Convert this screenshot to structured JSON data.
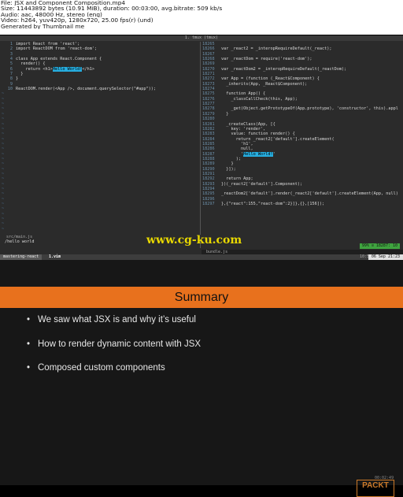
{
  "meta": {
    "lines": [
      "File: JSX and Component Composition.mp4",
      "Size: 11443892 bytes (10.91 MiB), duration: 00:03:00, avg.bitrate: 509 kb/s",
      "Audio: aac, 48000 Hz, stereo (eng)",
      "Video: h264, yuv420p, 1280x720, 25.00 fps(r) (und)",
      "Generated by Thumbnail me"
    ]
  },
  "tmux": {
    "title": "1. tmux (tmux)",
    "session": "mastering-react",
    "window": "1.vim",
    "time": "10:57",
    "date": "06 Sep 21:23"
  },
  "left_pane": {
    "lines": [
      {
        "n": "1",
        "t": "import React from 'react';"
      },
      {
        "n": "2",
        "t": "import ReactDOM from 'react-dom';"
      },
      {
        "n": "3",
        "t": ""
      },
      {
        "n": "4",
        "t": "class App extends React.Component {"
      },
      {
        "n": "5",
        "t": "  render() {"
      },
      {
        "n": "6",
        "t": "    return <h1>",
        "hl": "Hello World!",
        "tail": "</h1>"
      },
      {
        "n": "7",
        "t": "  }"
      },
      {
        "n": "8",
        "t": "}"
      },
      {
        "n": "9",
        "t": ""
      },
      {
        "n": "10",
        "t": "ReactDOM.render(<App />, document.querySelector(\"#app\"));"
      }
    ],
    "filename": "src/main.js",
    "command": "/hello world"
  },
  "right_pane": {
    "lines": [
      {
        "n": "18265",
        "t": ""
      },
      {
        "n": "18266",
        "t": "var _react2 = _interopRequireDefault(_react);"
      },
      {
        "n": "18267",
        "t": ""
      },
      {
        "n": "18268",
        "t": "var _reactDom = require('react-dom');"
      },
      {
        "n": "18269",
        "t": ""
      },
      {
        "n": "18270",
        "t": "var _reactDom2 = _interopRequireDefault(_reactDom);"
      },
      {
        "n": "18271",
        "t": ""
      },
      {
        "n": "18272",
        "t": "var App = (function (_React$Component) {"
      },
      {
        "n": "18273",
        "t": "  _inherits(App, _React$Component);"
      },
      {
        "n": "18274",
        "t": ""
      },
      {
        "n": "18275",
        "t": "  function App() {"
      },
      {
        "n": "18276",
        "t": "    _classCallCheck(this, App);"
      },
      {
        "n": "18277",
        "t": ""
      },
      {
        "n": "18278",
        "t": "    _get(Object.getPrototypeOf(App.prototype), 'constructor', this).appl"
      },
      {
        "n": "18279",
        "t": "  }"
      },
      {
        "n": "18280",
        "t": ""
      },
      {
        "n": "18281",
        "t": "  _createClass(App, [{"
      },
      {
        "n": "18282",
        "t": "    key: 'render',"
      },
      {
        "n": "18283",
        "t": "    value: function render() {"
      },
      {
        "n": "18284",
        "t": "      return _react2['default'].createElement("
      },
      {
        "n": "18285",
        "t": "        'h1',"
      },
      {
        "n": "18286",
        "t": "        null,"
      },
      {
        "n": "18287",
        "t": "        '",
        "hl": "Hello World!",
        "tail": "'"
      },
      {
        "n": "18288",
        "t": "      );"
      },
      {
        "n": "18289",
        "t": "    }"
      },
      {
        "n": "18290",
        "t": "  }]);"
      },
      {
        "n": "18291",
        "t": ""
      },
      {
        "n": "18292",
        "t": "  return App;"
      },
      {
        "n": "18293",
        "t": "})(_react2['default'].Component);"
      },
      {
        "n": "18294",
        "t": ""
      },
      {
        "n": "18295",
        "t": "_reactDom2['default'].render(_react2['default'].createElement(App, null)"
      },
      {
        "n": "18296",
        "t": ""
      },
      {
        "n": "18297",
        "t": "},{\"react\":155,\"react-dom\":2}]},{},[156]);"
      }
    ],
    "filename": "bundle.js",
    "position": "99% ≡ 18287: 10"
  },
  "watermark": "www.cg-ku.com",
  "slide": {
    "title": "Summary",
    "bullets": [
      "We saw what JSX is and why it’s useful",
      "How to render dynamic content with JSX",
      "Composed custom components"
    ],
    "logo": "PACKT",
    "timestamp": "00:02:49"
  },
  "colors": {
    "accent": "#e8711d",
    "highlight": "#27aee0",
    "slide_bg": "#171717",
    "terminal_bg": "#2b2b2b"
  }
}
